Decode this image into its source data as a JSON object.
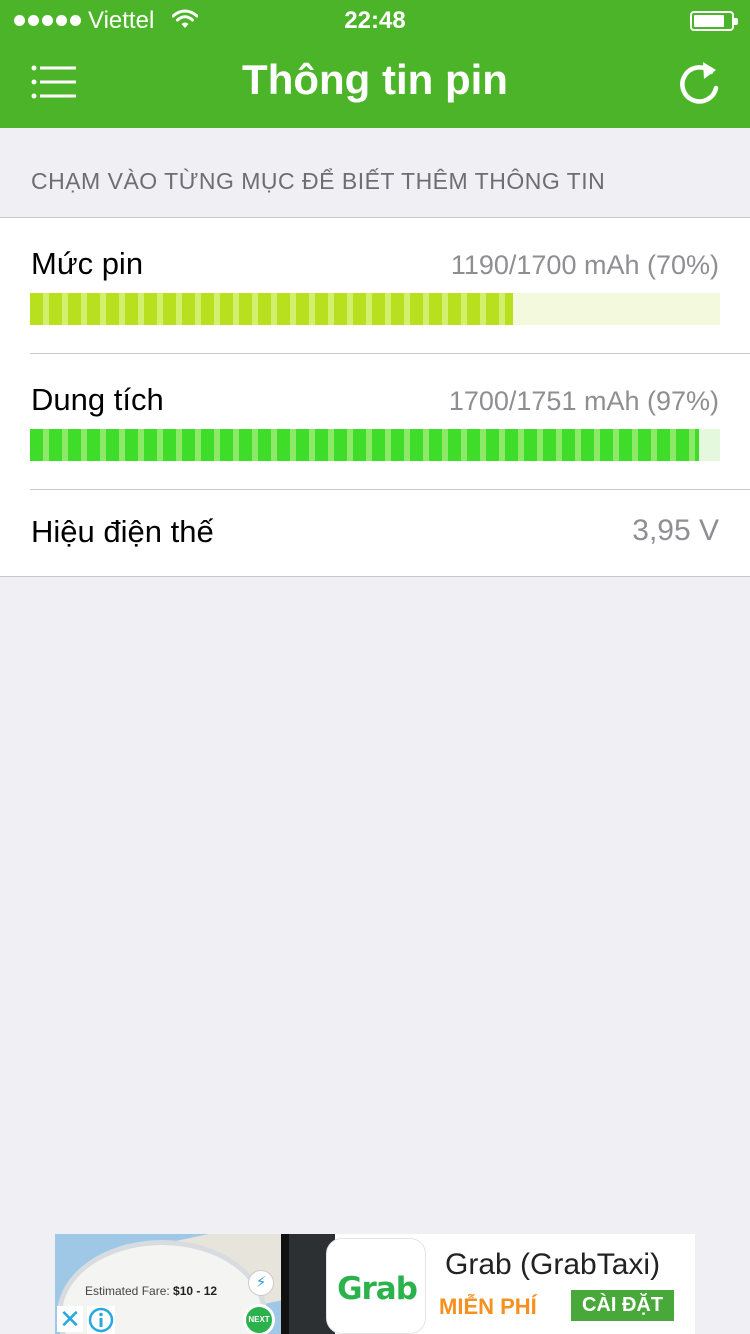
{
  "status_bar": {
    "carrier": "Viettel",
    "time": "22:48"
  },
  "header": {
    "title": "Thông tin pin",
    "menu_icon": "list-menu-icon",
    "refresh_icon": "refresh-icon"
  },
  "hint": "CHẠM VÀO TỪNG MỤC ĐỂ BIẾT THÊM THÔNG TIN",
  "items": [
    {
      "label": "Mức pin",
      "value": "1190/1700 mAh (70%)",
      "level": 0.7,
      "colors": [
        "#b9e01e",
        "#d3ef6e"
      ],
      "track": "#f2f9dc"
    },
    {
      "label": "Dung tích",
      "value": "1700/1751 mAh (97%)",
      "level": 0.97,
      "colors": [
        "#3fdc2a",
        "#8ee86a"
      ],
      "track": "#e3f8dc"
    },
    {
      "label": "Hiệu điện thế",
      "value": "3,95 V"
    }
  ],
  "ad": {
    "fare_label": "Estimated Fare:",
    "fare_value": "$10 - 12",
    "next_label": "NEXT",
    "logo_text": "Grab",
    "app_name": "Grab (GrabTaxi)",
    "price": "MIỄN PHÍ",
    "install": "CÀI ĐẶT"
  }
}
